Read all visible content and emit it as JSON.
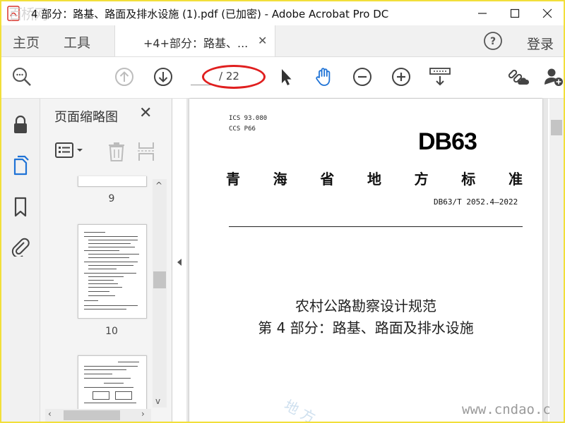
{
  "window": {
    "title": "4 部分：路基、路面及排水设施 (1).pdf (已加密) - Adobe Acrobat Pro DC",
    "watermark_logo": "百桥网"
  },
  "tabbar": {
    "home": "主页",
    "tools": "工具",
    "doc_tab": "+4+部分：路基、...",
    "login": "登录"
  },
  "toolbar": {
    "page_current": "",
    "page_total": "/ 22"
  },
  "thumbnail_pane": {
    "title": "页面缩略图",
    "thumbs": [
      {
        "number": "9"
      },
      {
        "number": "10"
      }
    ]
  },
  "document": {
    "ics": "ICS  93.080",
    "ccs": "CCS  P66",
    "logo": "DB63",
    "province_chars": [
      "青",
      "海",
      "省",
      "地",
      "方",
      "标",
      "准"
    ],
    "standard_number": "DB63/T 2052.4—2022",
    "title_line1": "农村公路勘察设计规范",
    "title_line2": "第 4 部分：路基、路面及排水设施",
    "watermark_bottom": "地 方",
    "watermark_site": "www.cndao.com"
  },
  "colors": {
    "frame_border": "#f2df3a",
    "annotation_red": "#e01f1f",
    "accent_blue": "#1f73d6"
  }
}
